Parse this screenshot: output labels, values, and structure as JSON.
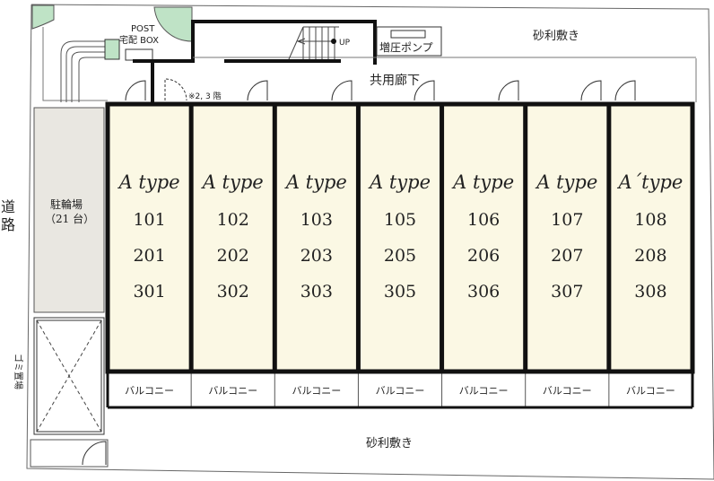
{
  "labels": {
    "road": "道路",
    "road_ch1": "道",
    "road_ch2": "路",
    "gravel_top": "砂利敷き",
    "gravel_bottom": "砂利敷き",
    "corridor": "共用廊下",
    "booster_pump": "増圧ポンプ",
    "delivery_box_line1": "POST",
    "delivery_box_line2": "宅配 BOX",
    "stairs_up": "UP",
    "stair_note": "※2, 3 階",
    "parking_line1": "駐輪場",
    "parking_line2": "（21 台）",
    "garbage": "ゴミ置場"
  },
  "units": [
    {
      "type": "A type",
      "rooms": [
        "101",
        "201",
        "301"
      ],
      "balcony": "バルコニー"
    },
    {
      "type": "A type",
      "rooms": [
        "102",
        "202",
        "302"
      ],
      "balcony": "バルコニー"
    },
    {
      "type": "A type",
      "rooms": [
        "103",
        "203",
        "303"
      ],
      "balcony": "バルコニー"
    },
    {
      "type": "A type",
      "rooms": [
        "105",
        "205",
        "305"
      ],
      "balcony": "バルコニー"
    },
    {
      "type": "A type",
      "rooms": [
        "106",
        "206",
        "306"
      ],
      "balcony": "バルコニー"
    },
    {
      "type": "A type",
      "rooms": [
        "107",
        "207",
        "307"
      ],
      "balcony": "バルコニー"
    },
    {
      "type": "A´type",
      "rooms": [
        "108",
        "208",
        "308"
      ],
      "balcony": "バルコニー"
    }
  ],
  "colors": {
    "unit_fill": "#fbf8e4",
    "parking_fill": "#e9e7e1",
    "tree": "#bfe3c6",
    "wall": "#111111"
  }
}
